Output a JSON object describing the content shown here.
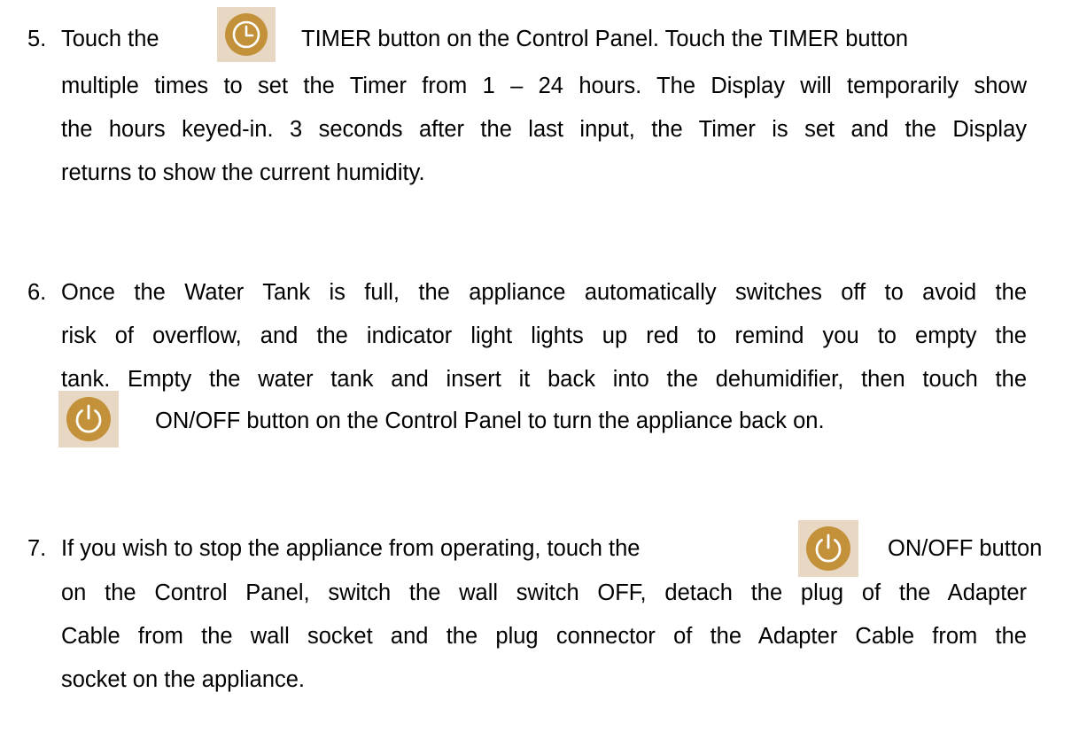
{
  "items": [
    {
      "number": "5.",
      "lines": [
        {
          "before": "Touch the",
          "after": "TIMER button on the Control Panel. Touch the TIMER button"
        },
        "multiple times to set the Timer from 1 – 24 hours. The Display will temporarily show",
        "the hours keyed-in. 3 seconds after the last input, the Timer is set and the Display",
        "returns to show the current humidity."
      ],
      "icon": "timer-clock-icon"
    },
    {
      "number": "6.",
      "lines": [
        "Once the Water Tank is full, the appliance automatically switches off to avoid the",
        "risk of overflow, and the indicator light lights up red to remind you to empty the",
        "tank. Empty the water tank and insert it back into the dehumidifier, then touch the",
        {
          "after": "ON/OFF button on the Control Panel to turn the appliance back on."
        }
      ],
      "icon": "power-icon"
    },
    {
      "number": "7.",
      "lines": [
        {
          "before": "If you wish to stop the appliance from operating, touch the",
          "after": "ON/OFF button"
        },
        "on the Control Panel, switch the wall switch OFF, detach the plug of the Adapter",
        "Cable from the wall socket and the plug connector of the Adapter Cable from the",
        "socket on the appliance."
      ],
      "icon": "power-icon"
    }
  ],
  "colors": {
    "icon_background": "#e8d8c3",
    "icon_fill": "#c2913a",
    "icon_stroke": "#ffffff"
  }
}
